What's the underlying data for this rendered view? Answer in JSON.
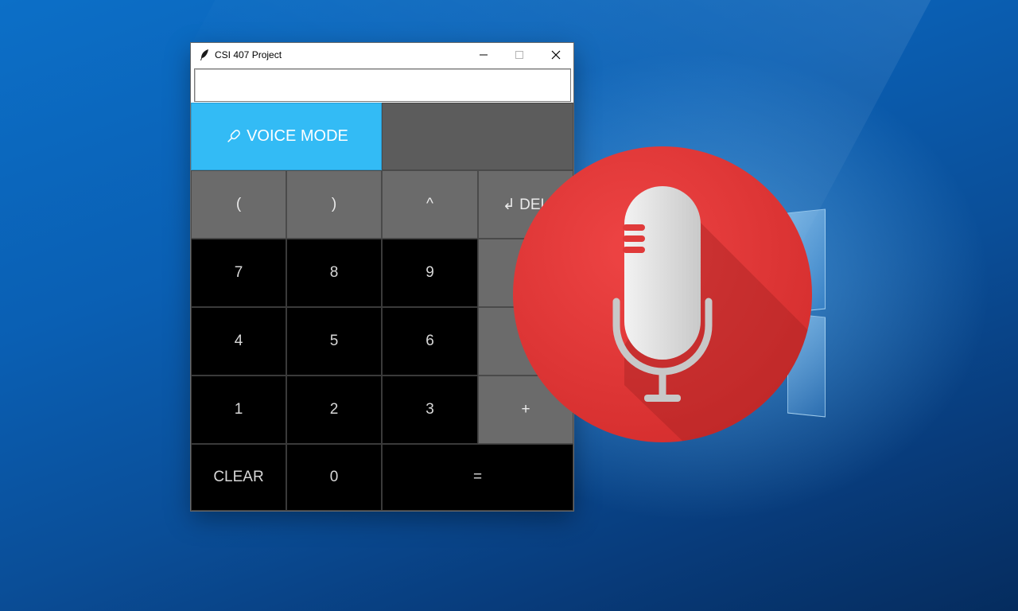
{
  "window": {
    "title": "CSI 407 Project"
  },
  "display": {
    "value": "",
    "placeholder": ""
  },
  "voice_button": {
    "label": "VOICE MODE",
    "icon": "microphone-icon"
  },
  "rows": [
    {
      "row": 1,
      "buttons": [
        "(",
        ")",
        "^",
        "↲ DEL"
      ]
    },
    {
      "row": 2,
      "buttons": [
        "7",
        "8",
        "9",
        ""
      ]
    },
    {
      "row": 3,
      "buttons": [
        "4",
        "5",
        "6",
        ""
      ]
    },
    {
      "row": 4,
      "buttons": [
        "1",
        "2",
        "3",
        "+"
      ]
    },
    {
      "row": 5,
      "buttons": [
        "CLEAR",
        "0",
        "="
      ]
    }
  ],
  "labels": {
    "open_paren": "(",
    "close_paren": ")",
    "power": "^",
    "delete": "↲ DEL",
    "seven": "7",
    "eight": "8",
    "nine": "9",
    "four": "4",
    "five": "5",
    "six": "6",
    "one": "1",
    "two": "2",
    "three": "3",
    "plus": "+",
    "clear": "CLEAR",
    "zero": "0",
    "equals": "="
  },
  "colors": {
    "voice_blue": "#33bbf5",
    "operator_gray": "#6b6b6b",
    "digit_black": "#000000",
    "mic_red": "#e23a3a",
    "desktop_blue": "#0a5fb3"
  }
}
